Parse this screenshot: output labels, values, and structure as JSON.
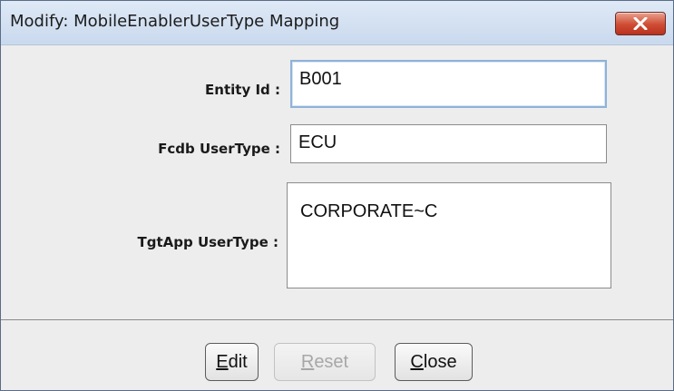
{
  "window": {
    "title": "Modify: MobileEnablerUserType Mapping"
  },
  "icons": {
    "close": "close-icon"
  },
  "colors": {
    "title_gradient_top": "#dfe9f6",
    "title_gradient_bottom": "#c9d9ee",
    "close_button": "#cf4b33",
    "dialog_background": "#ededed",
    "focus_border": "#8fb2d9"
  },
  "form": {
    "entity_id": {
      "label": "Entity Id :",
      "value": "B001"
    },
    "fcdb_usertype": {
      "label": "Fcdb UserType :",
      "value": "ECU"
    },
    "tgtapp_usertype": {
      "label": "TgtApp UserType :",
      "value": "CORPORATE~C"
    }
  },
  "buttons": {
    "edit": {
      "mnemonic": "E",
      "rest": "dit",
      "enabled": true
    },
    "reset": {
      "mnemonic": "R",
      "rest": "eset",
      "enabled": false
    },
    "close": {
      "mnemonic": "C",
      "rest": "lose",
      "enabled": true
    }
  }
}
